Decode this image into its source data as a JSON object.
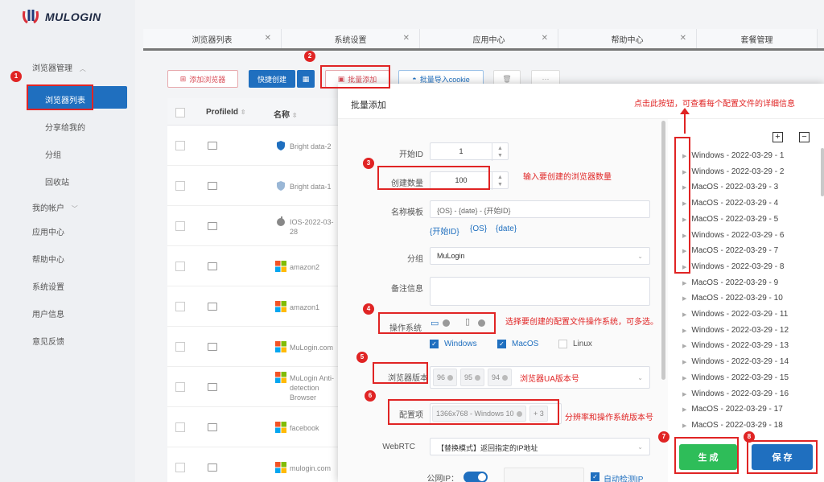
{
  "app": {
    "logo_text": "MULOGIN"
  },
  "sidebar": {
    "browser_mgmt": "浏览器管理",
    "browser_list": "浏览器列表",
    "share": "分享给我的",
    "group": "分组",
    "recycle": "回收站",
    "my_account": "我的帐户",
    "app_center": "应用中心",
    "help_center": "帮助中心",
    "system_settings": "系统设置",
    "user_info": "用户信息",
    "feedback": "意见反馈"
  },
  "tabs": [
    {
      "label": "浏览器列表"
    },
    {
      "label": "系统设置"
    },
    {
      "label": "应用中心"
    },
    {
      "label": "帮助中心"
    },
    {
      "label": "套餐管理"
    }
  ],
  "toolbar": {
    "add_browser": "添加浏览器",
    "quick_create": "快捷创建",
    "batch_add": "批量添加",
    "batch_import_cookie": "批量导入cookie",
    "more": "···"
  },
  "table": {
    "col_profile": "ProfileId",
    "col_name": "名称",
    "rows": [
      {
        "name": "Bright data-2"
      },
      {
        "name": "Bright data-1"
      },
      {
        "name": "IOS-2022-03-28"
      },
      {
        "name": "amazon2"
      },
      {
        "name": "amazon1"
      },
      {
        "name": "MuLogin.com"
      },
      {
        "name": "MuLogin Anti-detection Browser"
      },
      {
        "name": "facebook"
      },
      {
        "name": "mulogin.com"
      }
    ]
  },
  "modal": {
    "title": "批量添加",
    "start_id_label": "开始ID",
    "start_id_value": "1",
    "count_label": "创建数量",
    "count_value": "100",
    "name_tpl_label": "名称模板",
    "name_tpl_value": "{OS} - {date} - {开始ID}",
    "tpl_tags": [
      "{开始ID}",
      "{OS}",
      "{date}"
    ],
    "group_label": "分组",
    "group_value": "MuLogin",
    "note_label": "备注信息",
    "os_label": "操作系统",
    "os_options": [
      {
        "label": "Windows",
        "checked": true
      },
      {
        "label": "MacOS",
        "checked": true
      },
      {
        "label": "Linux",
        "checked": false
      }
    ],
    "browser_ver_label": "浏览器版本",
    "browser_versions": [
      "96",
      "95",
      "94"
    ],
    "config_label": "配置项",
    "config_value": "1366x768 - Windows 10",
    "config_more": "+ 3",
    "webrtc_label": "WebRTC",
    "webrtc_value": "【替换模式】返回指定的IP地址",
    "public_ip_label": "公网IP：",
    "auto_detect_ip": "自动检测IP",
    "generate": "生 成",
    "save": "保 存"
  },
  "tree": {
    "expand": "+",
    "collapse": "−",
    "items": [
      "Windows - 2022-03-29 - 1",
      "Windows - 2022-03-29 - 2",
      "MacOS - 2022-03-29 - 3",
      "MacOS - 2022-03-29 - 4",
      "MacOS - 2022-03-29 - 5",
      "Windows - 2022-03-29 - 6",
      "MacOS - 2022-03-29 - 7",
      "Windows - 2022-03-29 - 8",
      "MacOS - 2022-03-29 - 9",
      "MacOS - 2022-03-29 - 10",
      "Windows - 2022-03-29 - 11",
      "Windows - 2022-03-29 - 12",
      "Windows - 2022-03-29 - 13",
      "Windows - 2022-03-29 - 14",
      "Windows - 2022-03-29 - 15",
      "Windows - 2022-03-29 - 16",
      "MacOS - 2022-03-29 - 17",
      "MacOS - 2022-03-29 - 18"
    ]
  },
  "annotations": {
    "note_tree": "点击此按钮，可查看每个配置文件的详细信息",
    "note_count": "输入要创建的浏览器数量",
    "note_os": "选择要创建的配置文件操作系统，可多选。",
    "note_ver": "浏览器UA版本号",
    "note_config": "分辨率和操作系统版本号",
    "badges": [
      "1",
      "2",
      "3",
      "4",
      "5",
      "6",
      "7",
      "8"
    ]
  },
  "colors": {
    "primary": "#1f6fbf",
    "accent_red": "#e02424",
    "success": "#2ebd59"
  }
}
